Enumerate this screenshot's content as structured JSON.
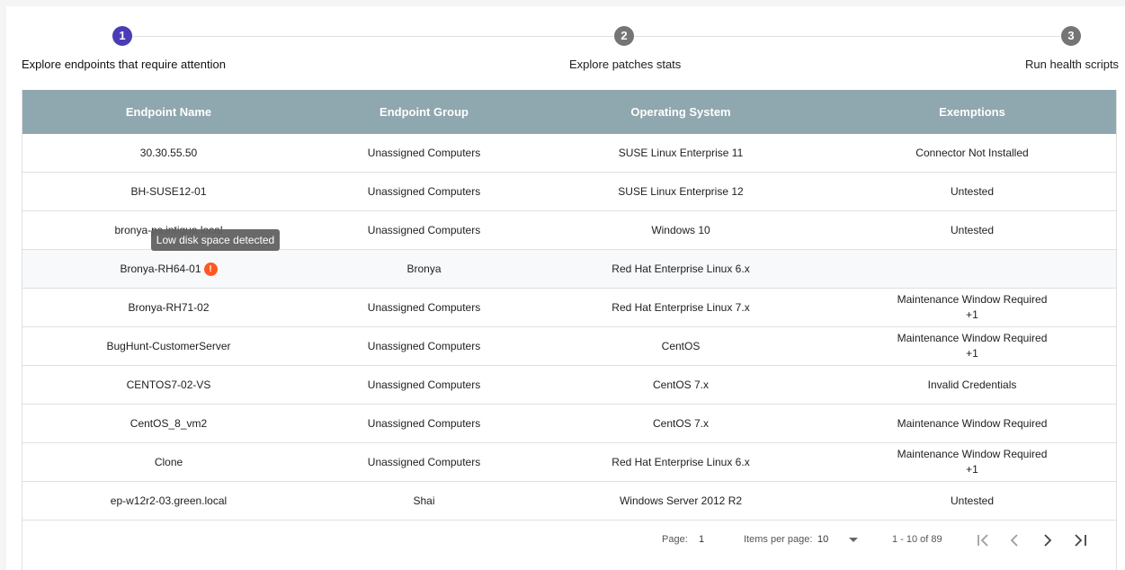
{
  "stepper": {
    "steps": [
      {
        "number": "1",
        "label": "Explore endpoints that require attention",
        "active": true
      },
      {
        "number": "2",
        "label": "Explore patches stats",
        "active": false
      },
      {
        "number": "3",
        "label": "Run health scripts",
        "active": false
      }
    ],
    "colors": {
      "active": "#4a3cb5",
      "inactive": "#757575"
    }
  },
  "table": {
    "headers": [
      "Endpoint Name",
      "Endpoint Group",
      "Operating System",
      "Exemptions"
    ],
    "header_color": "#8fa7ae",
    "rows": [
      {
        "name": "30.30.55.50",
        "group": "Unassigned Computers",
        "os": "SUSE Linux Enterprise 11",
        "exemptions": "Connector Not Installed",
        "extra": ""
      },
      {
        "name": "BH-SUSE12-01",
        "group": "Unassigned Computers",
        "os": "SUSE Linux Enterprise 12",
        "exemptions": "Untested",
        "extra": ""
      },
      {
        "name": "bronya-ps.intigua.local",
        "group": "Unassigned Computers",
        "os": "Windows 10",
        "exemptions": "Untested",
        "extra": ""
      },
      {
        "name": "Bronya-RH64-01",
        "group": "Bronya",
        "os": "Red Hat Enterprise Linux 6.x",
        "exemptions": "",
        "extra": "",
        "warning": true
      },
      {
        "name": "Bronya-RH71-02",
        "group": "Unassigned Computers",
        "os": "Red Hat Enterprise Linux 7.x",
        "exemptions": "Maintenance Window Required",
        "extra": "+1"
      },
      {
        "name": "BugHunt-CustomerServer",
        "group": "Unassigned Computers",
        "os": "CentOS",
        "exemptions": "Maintenance Window Required",
        "extra": "+1"
      },
      {
        "name": "CENTOS7-02-VS",
        "group": "Unassigned Computers",
        "os": "CentOS 7.x",
        "exemptions": "Invalid Credentials",
        "extra": ""
      },
      {
        "name": "CentOS_8_vm2",
        "group": "Unassigned Computers",
        "os": "CentOS 7.x",
        "exemptions": "Maintenance Window Required",
        "extra": ""
      },
      {
        "name": "Clone",
        "group": "Unassigned Computers",
        "os": "Red Hat Enterprise Linux 6.x",
        "exemptions": "Maintenance Window Required",
        "extra": "+1"
      },
      {
        "name": "ep-w12r2-03.green.local",
        "group": "Shai",
        "os": "Windows Server 2012 R2",
        "exemptions": "Untested",
        "extra": ""
      }
    ],
    "warning_icon": "exclamation-icon",
    "warning_color": "#ff5722"
  },
  "tooltip": {
    "text": "Low disk space detected"
  },
  "paginator": {
    "page_label": "Page:",
    "page_value": "1",
    "items_label": "Items per page:",
    "items_value": "10",
    "range": "1 - 10 of 89",
    "icons": [
      "first-page-icon",
      "prev-page-icon",
      "next-page-icon",
      "last-page-icon"
    ]
  }
}
